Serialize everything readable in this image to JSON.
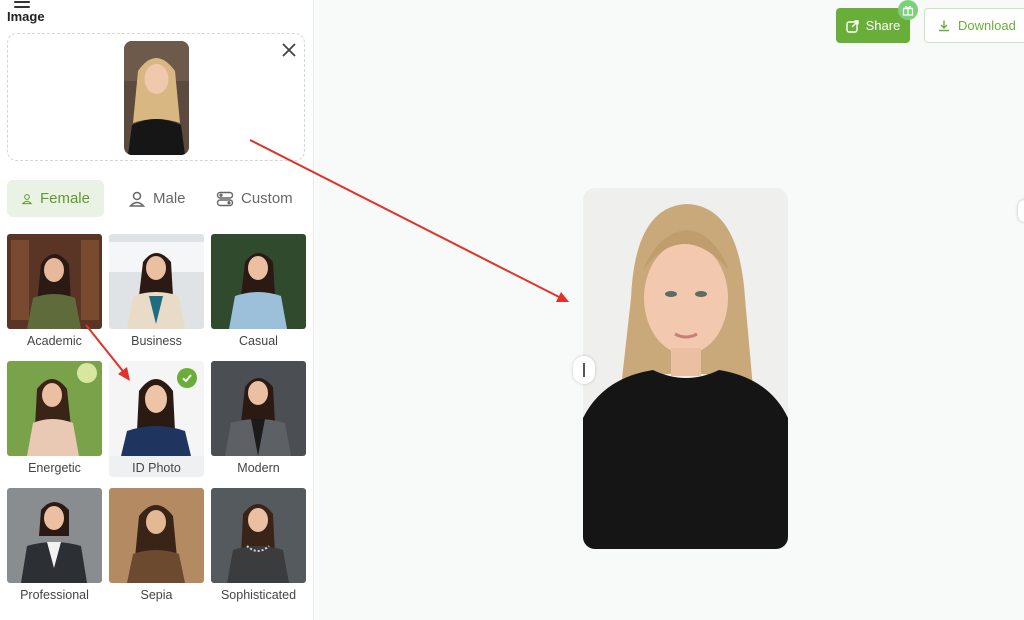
{
  "panel": {
    "title": "Image"
  },
  "tabs": [
    {
      "label": "Female",
      "icon": "female-user-icon",
      "active": true
    },
    {
      "label": "Male",
      "icon": "male-user-icon",
      "active": false
    },
    {
      "label": "Custom",
      "icon": "custom-toggle-icon",
      "active": false
    }
  ],
  "styles": [
    {
      "label": "Academic",
      "selected": false
    },
    {
      "label": "Business",
      "selected": false
    },
    {
      "label": "Casual",
      "selected": false
    },
    {
      "label": "Energetic",
      "selected": false
    },
    {
      "label": "ID Photo",
      "selected": true
    },
    {
      "label": "Modern",
      "selected": false
    },
    {
      "label": "Professional",
      "selected": false
    },
    {
      "label": "Sepia",
      "selected": false
    },
    {
      "label": "Sophisticated",
      "selected": false
    }
  ],
  "toolbar": {
    "share_label": "Share",
    "download_label": "Download"
  },
  "colors": {
    "accent": "#6aae3a",
    "accent_light": "#eaf2e6",
    "arrow": "#e0322a"
  }
}
